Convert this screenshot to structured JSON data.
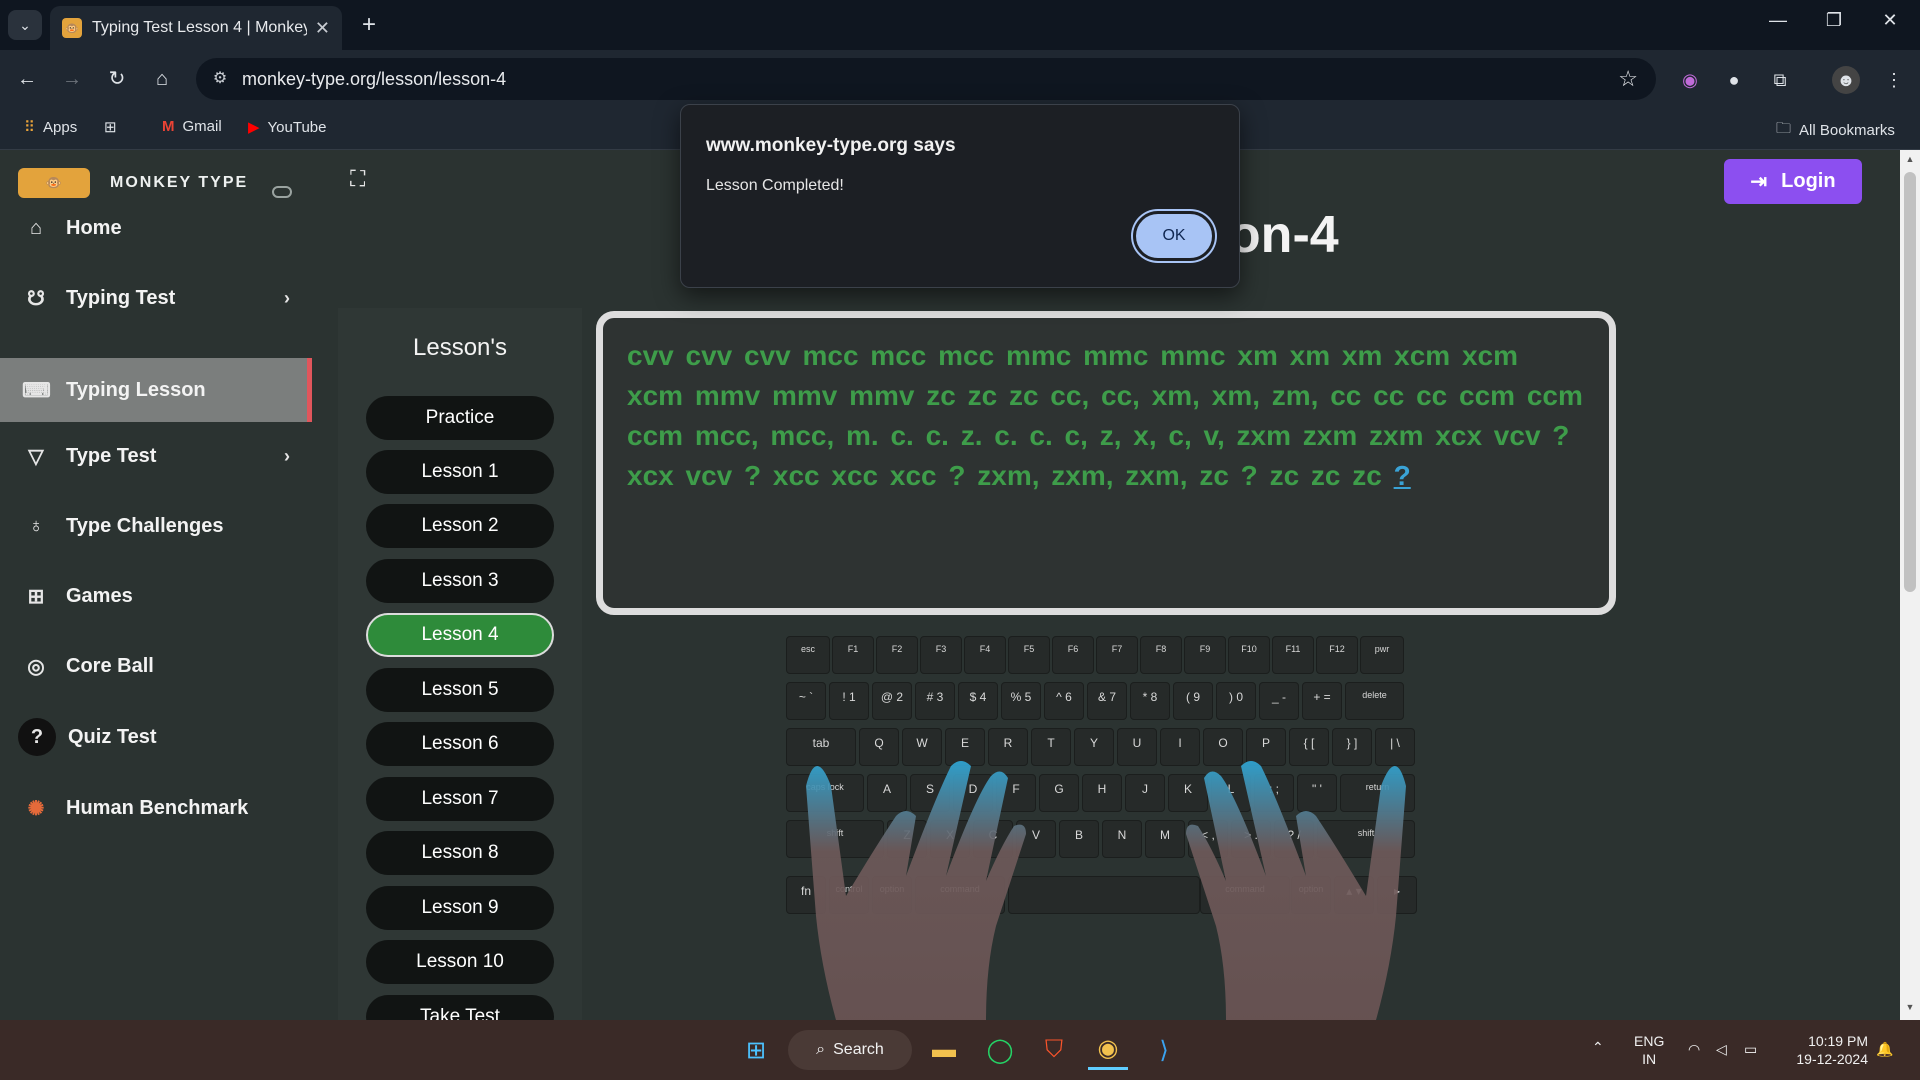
{
  "browser": {
    "tab_title": "Typing Test Lesson 4 | Monkey-",
    "url": "monkey-type.org/lesson/lesson-4",
    "bookmarks": [
      "Apps",
      "Gmail",
      "YouTube"
    ],
    "all_bookmarks": "All Bookmarks"
  },
  "sidebar": {
    "brand": "MONKEY TYPE",
    "logo_text": "🐵",
    "items": [
      {
        "label": "Home",
        "icon": "home-icon"
      },
      {
        "label": "Typing Test",
        "icon": "github-icon"
      },
      {
        "label": "Typing Lesson",
        "icon": "keyboard-icon"
      },
      {
        "label": "Type Test",
        "icon": "gitlab-icon"
      },
      {
        "label": "Type Challenges",
        "icon": "award-icon"
      },
      {
        "label": "Games",
        "icon": "grid-icon"
      },
      {
        "label": "Core Ball",
        "icon": "target-icon"
      },
      {
        "label": "Quiz Test",
        "icon": "quiz-icon"
      },
      {
        "label": "Human Benchmark",
        "icon": "brain-icon"
      }
    ]
  },
  "main": {
    "title": "son-4",
    "login_label": "Login",
    "lessons_title": "Lesson's",
    "lessons": [
      "Practice",
      "Lesson 1",
      "Lesson 2",
      "Lesson 3",
      "Lesson 4",
      "Lesson 5",
      "Lesson 6",
      "Lesson 7",
      "Lesson 8",
      "Lesson 9",
      "Lesson 10",
      "Take Test"
    ],
    "active_lesson": "Lesson 4",
    "typed_text": "cvv cvv cvv mcc mcc mcc mmc mmc mmc xm xm xm xcm xcm xcm mmv mmv mmv zc zc zc cc, cc, xm, xm, zm, cc cc cc ccm ccm ccm mcc, mcc, m. c. c. z. c. c. c, z, x, c, v, zxm zxm zxm xcx vcv ? xcx vcv ? xcc xcc xcc ? zxm, zxm, zxm, zc ? zc zc zc",
    "cursor_char": "?"
  },
  "dialog": {
    "title": "www.monkey-type.org says",
    "message": "Lesson Completed!",
    "ok_label": "OK"
  },
  "keyboard": {
    "rows": [
      [
        "esc",
        "F1",
        "F2",
        "F3",
        "F4",
        "F5",
        "F6",
        "F7",
        "F8",
        "F9",
        "F10",
        "F11",
        "F12",
        "pwr"
      ],
      [
        "~ `",
        "! 1",
        "@ 2",
        "# 3",
        "$ 4",
        "% 5",
        "^ 6",
        "& 7",
        "* 8",
        "( 9",
        ") 0",
        "_ -",
        "+ =",
        "delete"
      ],
      [
        "tab",
        "Q",
        "W",
        "E",
        "R",
        "T",
        "Y",
        "U",
        "I",
        "O",
        "P",
        "{ [",
        "} ]",
        "| \\"
      ],
      [
        "caps lock",
        "A",
        "S",
        "D",
        "F",
        "G",
        "H",
        "J",
        "K",
        "L",
        ": ;",
        "\" '",
        "return"
      ],
      [
        "shift",
        "Z",
        "X",
        "C",
        "V",
        "B",
        "N",
        "M",
        "< ,",
        "> .",
        "? /",
        "shift"
      ],
      [
        "fn",
        "control",
        "option",
        "command",
        "command",
        "option",
        "▴ ▾",
        "▸"
      ]
    ]
  },
  "taskbar": {
    "search_label": "Search",
    "lang_top": "ENG",
    "lang_bottom": "IN",
    "time": "10:19 PM",
    "date": "19-12-2024"
  },
  "colors": {
    "accent_purple": "#8c4ff0",
    "active_green": "#2e8b3a",
    "typed_green": "#3e9d4a",
    "active_marker": "#e0565c"
  }
}
